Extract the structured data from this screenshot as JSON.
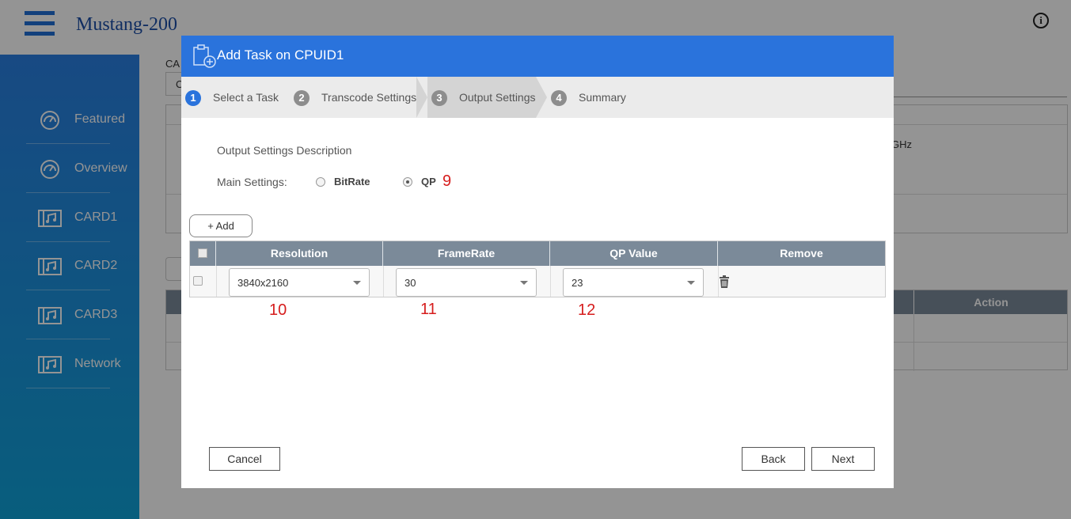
{
  "app": {
    "title": "Mustang-200"
  },
  "sidebar": {
    "items": [
      {
        "label": "Featured",
        "icon": "gauge-icon"
      },
      {
        "label": "Overview",
        "icon": "gauge-icon"
      },
      {
        "label": "CARD1",
        "icon": "film-card-icon"
      },
      {
        "label": "CARD2",
        "icon": "film-card-icon"
      },
      {
        "label": "CARD3",
        "icon": "film-card-icon"
      },
      {
        "label": "Network",
        "icon": "film-card-icon"
      }
    ]
  },
  "background": {
    "ca_label": "CA",
    "box_text": "C",
    "ghz_text": "GHz",
    "table_action_header": "Action"
  },
  "modal": {
    "title": "Add Task on CPUID1",
    "steps": [
      {
        "num": "1",
        "label": "Select a Task"
      },
      {
        "num": "2",
        "label": "Transcode Settings"
      },
      {
        "num": "3",
        "label": "Output Settings"
      },
      {
        "num": "4",
        "label": "Summary"
      }
    ],
    "description": "Output Settings Description",
    "main_settings_label": "Main Settings:",
    "radio_options": [
      {
        "label": "BitRate",
        "checked": false
      },
      {
        "label": "QP",
        "checked": true
      }
    ],
    "add_label": "+ Add",
    "table": {
      "headers": [
        "Resolution",
        "FrameRate",
        "QP Value",
        "Remove"
      ],
      "rows": [
        {
          "resolution": "3840x2160",
          "framerate": "30",
          "qp_value": "23"
        }
      ]
    },
    "annotations": [
      "9",
      "10",
      "11",
      "12"
    ],
    "buttons": {
      "cancel": "Cancel",
      "back": "Back",
      "next": "Next"
    }
  },
  "colors": {
    "accent": "#2a73dc",
    "sidebar_top": "#2a7fe2",
    "sidebar_bottom": "#0fa2d8",
    "table_header": "#7b8a99",
    "annotation": "#d61d1d"
  }
}
